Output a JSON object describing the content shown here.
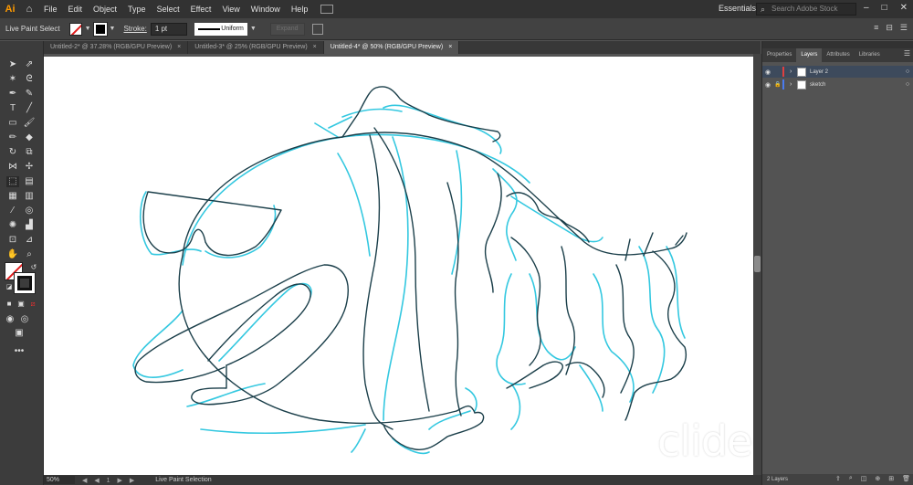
{
  "app": {
    "logo": "Ai",
    "home_icon": "home-icon"
  },
  "menu": [
    "File",
    "Edit",
    "Object",
    "Type",
    "Select",
    "Effect",
    "View",
    "Window",
    "Help"
  ],
  "workspace": {
    "label": "Essentials",
    "search_placeholder": "Search Adobe Stock"
  },
  "control_bar": {
    "selection_label": "Live Paint Select",
    "stroke_label": "Stroke:",
    "stroke_weight": "1 pt",
    "profile": "Uniform",
    "disabled_button": "Expand"
  },
  "tabs": [
    {
      "label": "Untitled-2* @ 37.28% (RGB/GPU Preview)",
      "close": "×"
    },
    {
      "label": "Untitled-3* @ 25% (RGB/GPU Preview)",
      "close": "×"
    },
    {
      "label": "Untitled-4* @ 50% (RGB/GPU Preview)",
      "close": "×"
    }
  ],
  "status": {
    "zoom": "50%",
    "artboard_nav": "◀ ◀ 1 ▶ ▶",
    "mode": "Live Paint Selection"
  },
  "panel": {
    "tabs": [
      "Properties",
      "Layers",
      "Attributes",
      "Libraries"
    ],
    "layers": [
      {
        "name": "Layer 2",
        "color": "#e0403f"
      },
      {
        "name": "sketch",
        "color": "#4a7bf0"
      }
    ],
    "footer": "2 Layers"
  },
  "colors": {
    "sketch_stroke": "#34c8e0",
    "line_stroke": "#1b3f4a",
    "accent": "#ff9a00"
  },
  "watermark": "clideo.com"
}
